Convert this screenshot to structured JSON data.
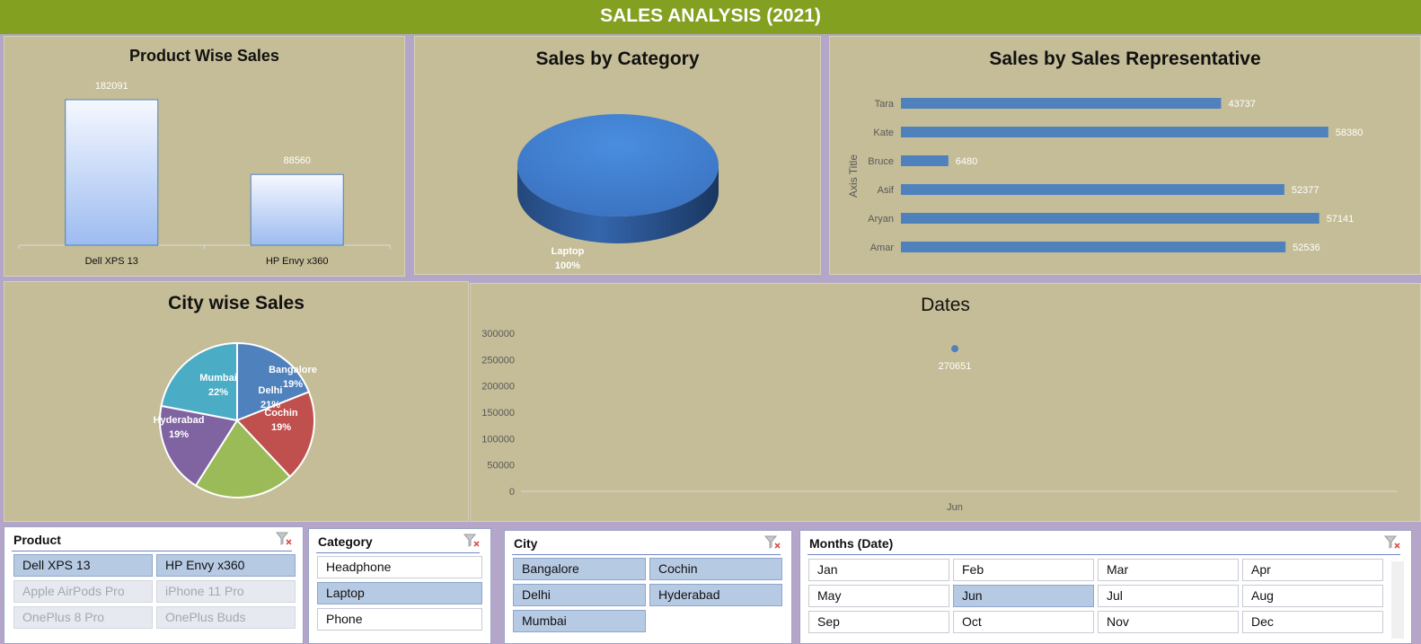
{
  "header": {
    "title": "SALES ANALYSIS (2021)"
  },
  "chart_data": [
    {
      "type": "bar",
      "title": "Product Wise Sales",
      "categories": [
        "Dell XPS 13",
        "HP Envy x360"
      ],
      "values": [
        182091,
        88560
      ],
      "value_labels": [
        "182091",
        "88560"
      ],
      "ylim": [
        0,
        182091
      ]
    },
    {
      "type": "pie",
      "title": "Sales by Category",
      "style": "3d",
      "labels": [
        "Laptop"
      ],
      "values": [
        100
      ],
      "value_labels": [
        "100%"
      ]
    },
    {
      "type": "bar",
      "orientation": "horizontal",
      "title": "Sales by Sales Representative",
      "ylabel": "Axis Title",
      "categories": [
        "Tara",
        "Kate",
        "Bruce",
        "Asif",
        "Aryan",
        "Amar"
      ],
      "values": [
        43737,
        58380,
        6480,
        52377,
        57141,
        52536
      ],
      "value_labels": [
        "43737",
        "58380",
        "6480",
        "52377",
        "57141",
        "52536"
      ],
      "xlim": [
        0,
        60000
      ]
    },
    {
      "type": "pie",
      "title": "City wise Sales",
      "labels": [
        "Bangalore",
        "Cochin",
        "Delhi",
        "Hyderabad",
        "Mumbai"
      ],
      "values": [
        19,
        19,
        21,
        19,
        22
      ],
      "value_labels": [
        "19%",
        "19%",
        "21%",
        "19%",
        "22%"
      ],
      "colors": [
        "#4f81bd",
        "#c0504d",
        "#9bbb59",
        "#8064a2",
        "#4bacc6"
      ]
    },
    {
      "type": "line",
      "title": "Dates",
      "categories": [
        "Jun"
      ],
      "values": [
        270651
      ],
      "value_labels": [
        "270651"
      ],
      "ylim": [
        0,
        300000
      ],
      "yticks": [
        "300000",
        "250000",
        "200000",
        "150000",
        "100000",
        "50000",
        "0"
      ]
    }
  ],
  "slicers": {
    "product": {
      "title": "Product",
      "items": [
        {
          "label": "Dell XPS 13",
          "state": "selected"
        },
        {
          "label": "HP Envy x360",
          "state": "selected"
        },
        {
          "label": "Apple AirPods Pro",
          "state": "disabled"
        },
        {
          "label": "iPhone 11 Pro",
          "state": "disabled"
        },
        {
          "label": "OnePlus 8 Pro",
          "state": "disabled"
        },
        {
          "label": "OnePlus Buds",
          "state": "disabled"
        }
      ]
    },
    "category": {
      "title": "Category",
      "items": [
        {
          "label": "Headphone",
          "state": "normal"
        },
        {
          "label": "Laptop",
          "state": "selected"
        },
        {
          "label": "Phone",
          "state": "normal"
        }
      ]
    },
    "city": {
      "title": "City",
      "items": [
        {
          "label": "Bangalore",
          "state": "selected"
        },
        {
          "label": "Cochin",
          "state": "selected"
        },
        {
          "label": "Delhi",
          "state": "selected"
        },
        {
          "label": "Hyderabad",
          "state": "selected"
        },
        {
          "label": "Mumbai",
          "state": "selected"
        }
      ]
    },
    "months": {
      "title": "Months (Date)",
      "items": [
        {
          "label": "Jan",
          "state": "normal"
        },
        {
          "label": "Feb",
          "state": "normal"
        },
        {
          "label": "Mar",
          "state": "normal"
        },
        {
          "label": "Apr",
          "state": "normal"
        },
        {
          "label": "May",
          "state": "normal"
        },
        {
          "label": "Jun",
          "state": "selected"
        },
        {
          "label": "Jul",
          "state": "normal"
        },
        {
          "label": "Aug",
          "state": "normal"
        },
        {
          "label": "Sep",
          "state": "normal"
        },
        {
          "label": "Oct",
          "state": "normal"
        },
        {
          "label": "Nov",
          "state": "normal"
        },
        {
          "label": "Dec",
          "state": "normal"
        }
      ]
    }
  }
}
